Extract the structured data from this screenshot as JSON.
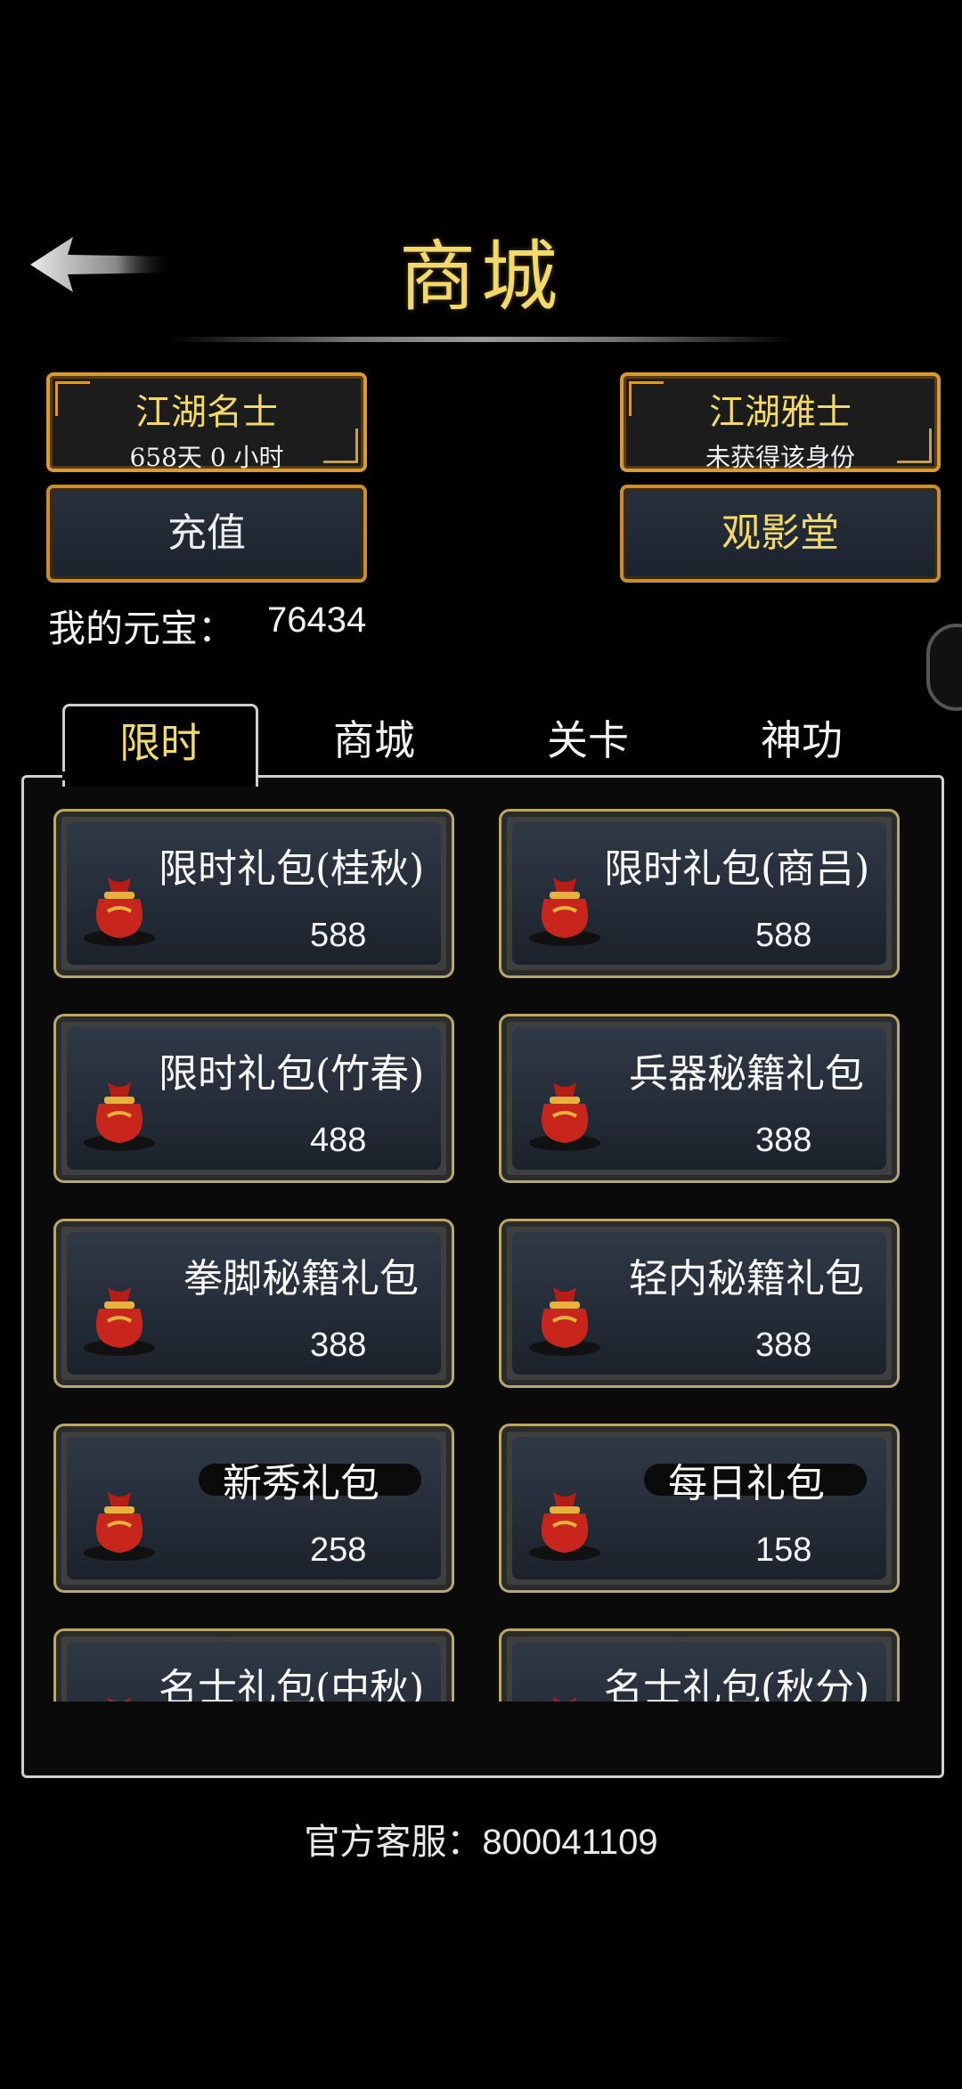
{
  "header": {
    "title": "商城",
    "back_icon": "back-arrow-icon"
  },
  "ranks": [
    {
      "title": "江湖名士",
      "status": "658天 0 小时"
    },
    {
      "title": "江湖雅士",
      "status": "未获得该身份"
    }
  ],
  "actions": {
    "recharge_label": "充值",
    "theater_label": "观影堂"
  },
  "balance": {
    "label": "我的元宝：",
    "value": "76434"
  },
  "tabs": [
    {
      "label": "限时",
      "active": true
    },
    {
      "label": "商城",
      "active": false
    },
    {
      "label": "关卡",
      "active": false
    },
    {
      "label": "神功",
      "active": false
    }
  ],
  "items": [
    {
      "name": "限时礼包(桂秋)",
      "price": "588",
      "icon": "gift-bag-icon"
    },
    {
      "name": "限时礼包(商吕)",
      "price": "588",
      "icon": "gift-bag-icon"
    },
    {
      "name": "限时礼包(竹春)",
      "price": "488",
      "icon": "gift-bag-icon"
    },
    {
      "name": "兵器秘籍礼包",
      "price": "388",
      "icon": "gift-bag-icon"
    },
    {
      "name": "拳脚秘籍礼包",
      "price": "388",
      "icon": "gift-bag-icon"
    },
    {
      "name": "轻内秘籍礼包",
      "price": "388",
      "icon": "gift-bag-icon"
    },
    {
      "name": "新秀礼包",
      "price": "258",
      "icon": "gift-bag-icon"
    },
    {
      "name": "每日礼包",
      "price": "158",
      "icon": "gift-bag-icon"
    },
    {
      "name": "名士礼包(中秋)",
      "price": "",
      "icon": "gift-bag-icon"
    },
    {
      "name": "名士礼包(秋分)",
      "price": "",
      "icon": "gift-bag-icon"
    }
  ],
  "support": {
    "label": "官方客服：",
    "value": "800041109"
  },
  "colors": {
    "gold_text": "#f3d86a",
    "frame_gold": "#d79a38",
    "card_bg": "#2f3946"
  }
}
